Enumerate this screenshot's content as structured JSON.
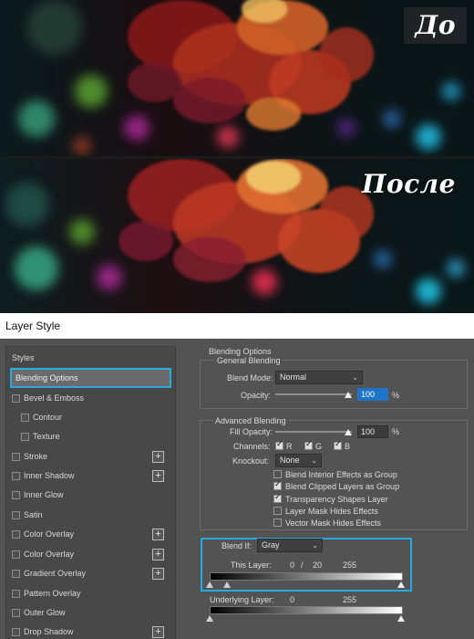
{
  "photos": {
    "before_label": "До",
    "after_label": "После"
  },
  "dialog": {
    "title": "Layer Style"
  },
  "styles_list": {
    "header": "Styles",
    "items": [
      {
        "label": "Blending Options",
        "selected": true
      },
      {
        "label": "Bevel & Emboss"
      },
      {
        "label": "Contour"
      },
      {
        "label": "Texture"
      },
      {
        "label": "Stroke"
      },
      {
        "label": "Inner Shadow"
      },
      {
        "label": "Inner Glow"
      },
      {
        "label": "Satin"
      },
      {
        "label": "Color Overlay"
      },
      {
        "label": "Color Overlay"
      },
      {
        "label": "Gradient Overlay"
      },
      {
        "label": "Pattern Overlay"
      },
      {
        "label": "Outer Glow"
      },
      {
        "label": "Drop Shadow"
      }
    ]
  },
  "blending": {
    "section_title": "Blending Options",
    "general_title": "General Blending",
    "blend_mode_label": "Blend Mode:",
    "blend_mode_value": "Normal",
    "opacity_label": "Opacity:",
    "opacity_value": "100",
    "opacity_unit": "%",
    "advanced_title": "Advanced Blending",
    "fill_opacity_label": "Fill Opacity:",
    "fill_opacity_value": "100",
    "fill_opacity_unit": "%",
    "channels_label": "Channels:",
    "channel_r": "R",
    "channel_g": "G",
    "channel_b": "B",
    "knockout_label": "Knockout:",
    "knockout_value": "None",
    "options": [
      {
        "label": "Blend Interior Effects as Group",
        "checked": false
      },
      {
        "label": "Blend Clipped Layers as Group",
        "checked": true
      },
      {
        "label": "Transparency Shapes Layer",
        "checked": true
      },
      {
        "label": "Layer Mask Hides Effects",
        "checked": false
      },
      {
        "label": "Vector Mask Hides Effects",
        "checked": false
      }
    ],
    "blend_if_label": "Blend If:",
    "blend_if_value": "Gray",
    "this_layer_label": "This Layer:",
    "this_layer_low": "0",
    "this_layer_sep": "/",
    "this_layer_mid": "20",
    "this_layer_high": "255",
    "underlying_label": "Underlying Layer:",
    "underlying_low": "0",
    "underlying_high": "255"
  },
  "colors": {
    "accent": "#29a9e0",
    "panel": "#535353",
    "active_input": "#1d74c9"
  }
}
